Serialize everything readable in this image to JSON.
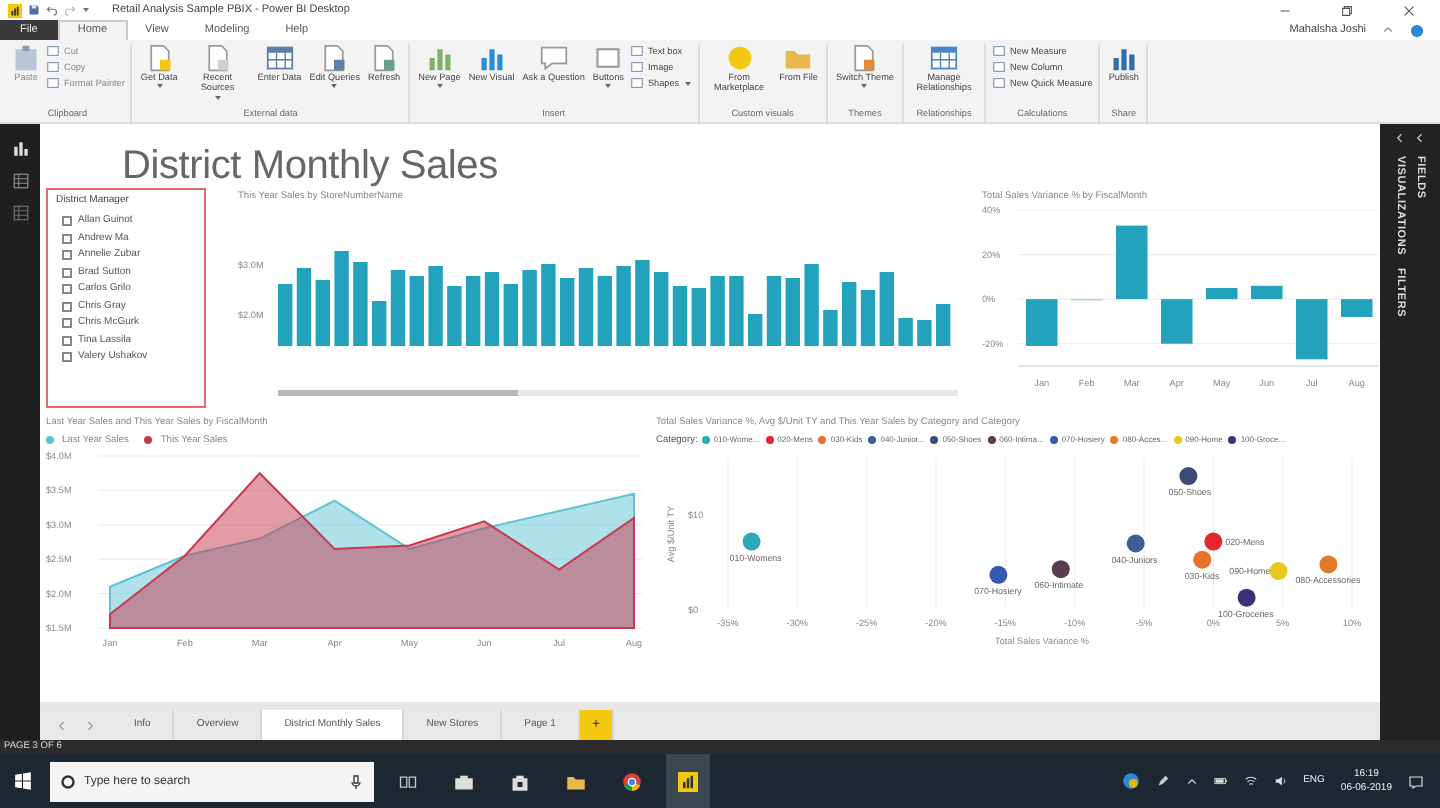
{
  "window": {
    "title": "Retail Analysis Sample PBIX - Power BI Desktop",
    "user": "Mahalsha Joshi"
  },
  "menu_tabs": [
    {
      "label": "File",
      "kind": "file",
      "selected": false
    },
    {
      "label": "Home",
      "kind": "tab",
      "selected": true
    },
    {
      "label": "View",
      "kind": "tab",
      "selected": false
    },
    {
      "label": "Modeling",
      "kind": "tab",
      "selected": false
    },
    {
      "label": "Help",
      "kind": "tab",
      "selected": false
    }
  ],
  "ribbon": {
    "groups": [
      {
        "label": "Clipboard",
        "buttons": [
          {
            "label": "Paste",
            "kind": "large",
            "disabled": true,
            "dropdown": false
          },
          {
            "label": "Cut",
            "kind": "small",
            "disabled": true,
            "dropdown": false
          },
          {
            "label": "Copy",
            "kind": "small",
            "disabled": true,
            "dropdown": false
          },
          {
            "label": "Format Painter",
            "kind": "small",
            "disabled": true,
            "dropdown": false
          }
        ]
      },
      {
        "label": "External data",
        "buttons": [
          {
            "label": "Get Data",
            "kind": "large",
            "disabled": false,
            "dropdown": true
          },
          {
            "label": "Recent Sources",
            "kind": "large",
            "disabled": false,
            "dropdown": true
          },
          {
            "label": "Enter Data",
            "kind": "large",
            "disabled": false,
            "dropdown": false
          },
          {
            "label": "Edit Queries",
            "kind": "large",
            "disabled": false,
            "dropdown": true
          },
          {
            "label": "Refresh",
            "kind": "large",
            "disabled": false,
            "dropdown": false
          }
        ]
      },
      {
        "label": "Insert",
        "buttons": [
          {
            "label": "New Page",
            "kind": "large",
            "disabled": false,
            "dropdown": true
          },
          {
            "label": "New Visual",
            "kind": "large",
            "disabled": false,
            "dropdown": false
          },
          {
            "label": "Ask a Question",
            "kind": "large",
            "disabled": false,
            "dropdown": false
          },
          {
            "label": "Buttons",
            "kind": "large",
            "disabled": false,
            "dropdown": true
          },
          {
            "label": "Text box",
            "kind": "small",
            "disabled": false,
            "dropdown": false
          },
          {
            "label": "Image",
            "kind": "small",
            "disabled": false,
            "dropdown": false
          },
          {
            "label": "Shapes",
            "kind": "small",
            "disabled": false,
            "dropdown": true
          }
        ]
      },
      {
        "label": "Custom visuals",
        "buttons": [
          {
            "label": "From Marketplace",
            "kind": "large",
            "disabled": false,
            "dropdown": false
          },
          {
            "label": "From File",
            "kind": "large",
            "disabled": false,
            "dropdown": false
          }
        ]
      },
      {
        "label": "Themes",
        "buttons": [
          {
            "label": "Switch Theme",
            "kind": "large",
            "disabled": false,
            "dropdown": true
          }
        ]
      },
      {
        "label": "Relationships",
        "buttons": [
          {
            "label": "Manage Relationships",
            "kind": "large",
            "disabled": false,
            "dropdown": false
          }
        ]
      },
      {
        "label": "Calculations",
        "buttons": [
          {
            "label": "New Measure",
            "kind": "small",
            "disabled": false,
            "dropdown": false
          },
          {
            "label": "New Column",
            "kind": "small",
            "disabled": false,
            "dropdown": false
          },
          {
            "label": "New Quick Measure",
            "kind": "small",
            "disabled": false,
            "dropdown": false
          }
        ]
      },
      {
        "label": "Share",
        "buttons": [
          {
            "label": "Publish",
            "kind": "large",
            "disabled": false,
            "dropdown": false
          }
        ]
      }
    ]
  },
  "report": {
    "title": "District Monthly Sales"
  },
  "slicer": {
    "title": "District Manager",
    "items": [
      {
        "label": "Allan Guinot",
        "checked": false
      },
      {
        "label": "Andrew Ma",
        "checked": false
      },
      {
        "label": "Annelie Zubar",
        "checked": false
      },
      {
        "label": "Brad Sutton",
        "checked": false
      },
      {
        "label": "Carlos Grilo",
        "checked": false
      },
      {
        "label": "Chris Gray",
        "checked": false
      },
      {
        "label": "Chris McGurk",
        "checked": false
      },
      {
        "label": "Tina Lassila",
        "checked": false
      },
      {
        "label": "Valery Ushakov",
        "checked": false
      }
    ]
  },
  "store_chart": {
    "title": "This Year Sales by StoreNumberName",
    "axis_labels": [
      "$3.0M",
      "$2.0M"
    ]
  },
  "variance_chart": {
    "chart_data": {
      "type": "bar",
      "title": "Total Sales Variance % by FiscalMonth",
      "categories": [
        "Jan",
        "Feb",
        "Mar",
        "Apr",
        "May",
        "Jun",
        "Jul",
        "Aug"
      ],
      "values": [
        -21,
        0,
        33,
        -20,
        5,
        6,
        -27,
        -8
      ],
      "grid": true,
      "ylim": [
        -30,
        40
      ],
      "yticks": [
        {
          "value": 40,
          "label": "40%"
        },
        {
          "value": 20,
          "label": "20%"
        },
        {
          "value": 0,
          "label": "0%"
        },
        {
          "value": -20,
          "label": "-20%"
        }
      ]
    }
  },
  "area_chart": {
    "chart_data": {
      "type": "area",
      "title": "Last Year Sales and This Year Sales by FiscalMonth",
      "categories": [
        "Jan",
        "Feb",
        "Mar",
        "Apr",
        "May",
        "Jun",
        "Jul",
        "Aug"
      ],
      "series": [
        {
          "name": "Last Year Sales",
          "color": "#5ec4d3",
          "values": [
            2.1,
            2.55,
            2.8,
            3.35,
            2.65,
            2.95,
            3.2,
            3.45
          ]
        },
        {
          "name": "This Year Sales",
          "color": "#c8384f",
          "values": [
            1.7,
            2.55,
            3.75,
            2.65,
            2.7,
            3.05,
            2.35,
            3.1
          ]
        }
      ],
      "grid": true,
      "legend": "top",
      "ylim": [
        1.5,
        4.0
      ],
      "yticks": [
        {
          "value": 4.0,
          "label": "$4.0M"
        },
        {
          "value": 3.5,
          "label": "$3.5M"
        },
        {
          "value": 3.0,
          "label": "$3.0M"
        },
        {
          "value": 2.5,
          "label": "$2.5M"
        },
        {
          "value": 2.0,
          "label": "$2.0M"
        },
        {
          "value": 1.5,
          "label": "$1.5M"
        }
      ]
    }
  },
  "scatter_chart": {
    "legend": {
      "title": "Category:",
      "items": [
        "010-Wome...",
        "020-Mens",
        "030-Kids",
        "040-Junior...",
        "050-Shoes",
        "060-Intima...",
        "070-Hosiery",
        "080-Acces...",
        "090-Home",
        "100-Groce..."
      ]
    },
    "chart_data": {
      "type": "scatter",
      "title": "Total Sales Variance %, Avg $/Unit TY and This Year Sales by Category and Category",
      "xlabel": "Total Sales Variance %",
      "ylabel": "Avg $/Unit TY",
      "grid": true,
      "xlim": [
        -35,
        10
      ],
      "ylim": [
        0,
        16
      ],
      "xticks": [
        {
          "value": -35,
          "label": "-35%"
        },
        {
          "value": -30,
          "label": "-30%"
        },
        {
          "value": -25,
          "label": "-25%"
        },
        {
          "value": -20,
          "label": "-20%"
        },
        {
          "value": -15,
          "label": "-15%"
        },
        {
          "value": -10,
          "label": "-10%"
        },
        {
          "value": -5,
          "label": "-5%"
        },
        {
          "value": 0,
          "label": "0%"
        },
        {
          "value": 5,
          "label": "5%"
        },
        {
          "value": 10,
          "label": "10%"
        }
      ],
      "yticks": [
        {
          "value": 0,
          "label": "$0"
        },
        {
          "value": 10,
          "label": "$10"
        }
      ],
      "series": [
        {
          "name": "010-Womens",
          "color": "#2ea8b8",
          "x": [
            -33.3
          ],
          "values": [
            7.2
          ]
        },
        {
          "name": "020-Mens",
          "color": "#e0282e",
          "x": [
            0
          ],
          "values": [
            7.2
          ]
        },
        {
          "name": "030-Kids",
          "color": "#e8712b",
          "x": [
            -0.8
          ],
          "values": [
            5.3
          ]
        },
        {
          "name": "040-Juniors",
          "color": "#3f5e96",
          "x": [
            -5.6
          ],
          "values": [
            7.0
          ]
        },
        {
          "name": "050-Shoes",
          "color": "#3b4a7a",
          "x": [
            -1.8
          ],
          "values": [
            14.1
          ]
        },
        {
          "name": "060-Intimate",
          "color": "#5a3c4a",
          "x": [
            -11
          ],
          "values": [
            4.3
          ]
        },
        {
          "name": "070-Hosiery",
          "color": "#3457b0",
          "x": [
            -15.5
          ],
          "values": [
            3.7
          ]
        },
        {
          "name": "080-Accessories",
          "color": "#e07b2c",
          "x": [
            8.3
          ],
          "values": [
            4.8
          ]
        },
        {
          "name": "090-Home",
          "color": "#e8c920",
          "x": [
            4.7
          ],
          "values": [
            4.1
          ]
        },
        {
          "name": "100-Groceries",
          "color": "#3e2f7a",
          "x": [
            2.4
          ],
          "values": [
            1.3
          ]
        }
      ]
    }
  },
  "panes": [
    {
      "labels": [
        "VISUALIZATIONS",
        "FILTERS"
      ]
    },
    {
      "labels": [
        "FIELDS"
      ]
    }
  ],
  "page_tabs": [
    {
      "label": "Info",
      "kind": "page",
      "selected": false
    },
    {
      "label": "Overview",
      "kind": "page",
      "selected": false
    },
    {
      "label": "District Monthly Sales",
      "kind": "page",
      "selected": true
    },
    {
      "label": "New Stores",
      "kind": "page",
      "selected": false
    },
    {
      "label": "Page 1",
      "kind": "page",
      "selected": false
    },
    {
      "label": "+",
      "kind": "add",
      "selected": false
    }
  ],
  "status_bar": "PAGE 3 OF 6",
  "taskbar": {
    "placeholder": "Type here to search",
    "language": "ENG",
    "time": "16:19",
    "date": "06-06-2019"
  }
}
